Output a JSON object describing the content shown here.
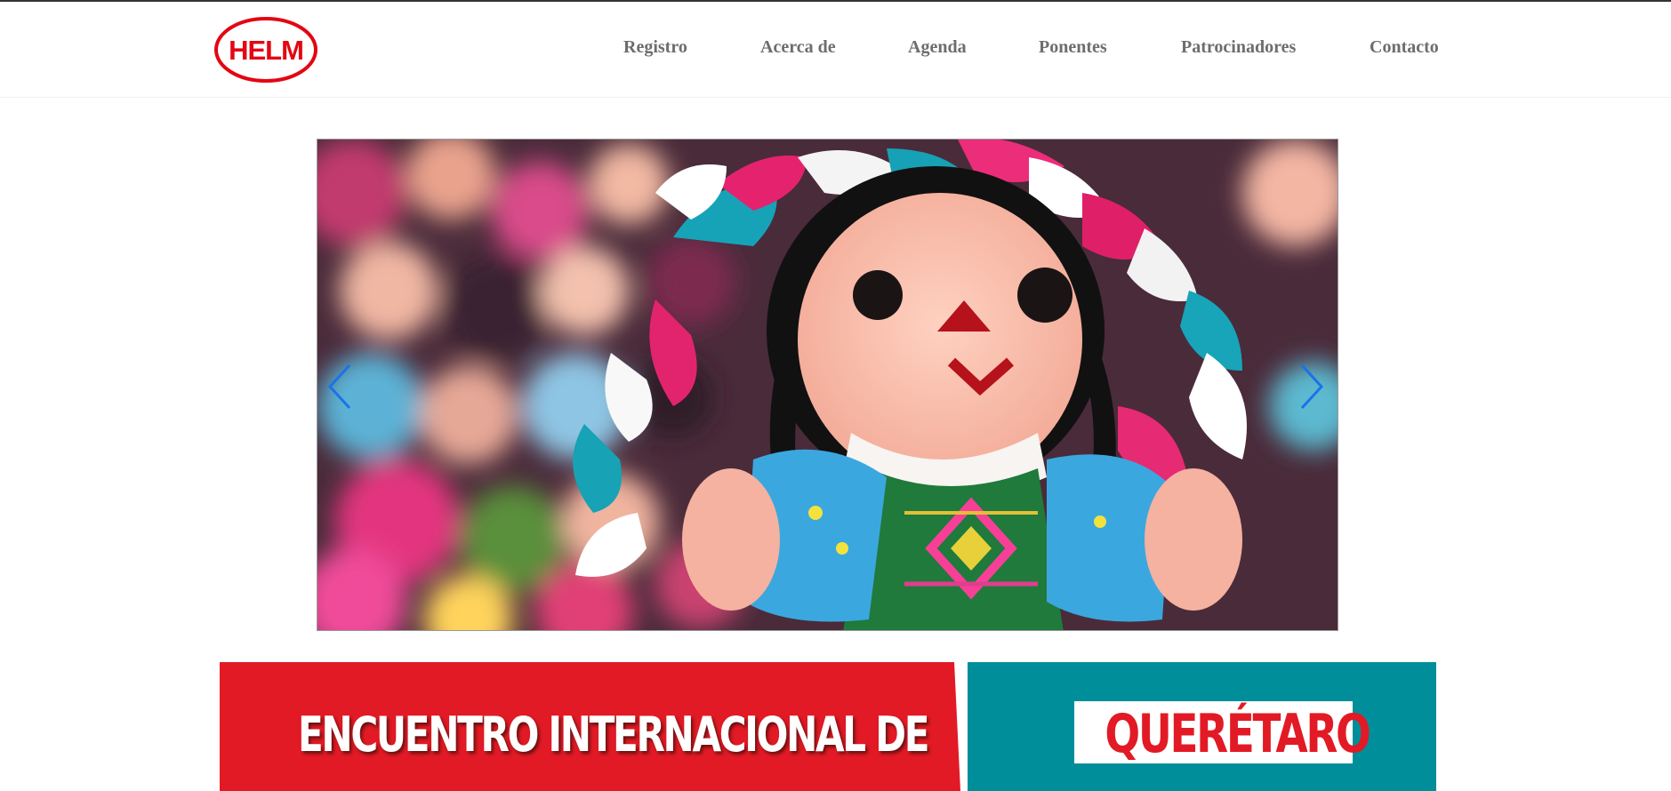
{
  "brand": {
    "logo_text": "HELM",
    "logo_color": "#e30613"
  },
  "nav": {
    "items": [
      {
        "label": "Registro"
      },
      {
        "label": "Acerca de"
      },
      {
        "label": "Agenda"
      },
      {
        "label": "Ponentes"
      },
      {
        "label": "Patrocinadores"
      },
      {
        "label": "Contacto"
      }
    ],
    "text_color": "#6d6d6d"
  },
  "carousel": {
    "image_subject": "mexican-rag-doll",
    "prev_icon": "chevron-left-icon",
    "next_icon": "chevron-right-icon",
    "arrow_color": "#1a73e8"
  },
  "banners": {
    "event": {
      "line1": "ENCUENTRO INTERNACIONAL DE",
      "background": "#e21a25"
    },
    "location": {
      "city": "QUERÉTARO",
      "background": "#008e9b"
    }
  }
}
